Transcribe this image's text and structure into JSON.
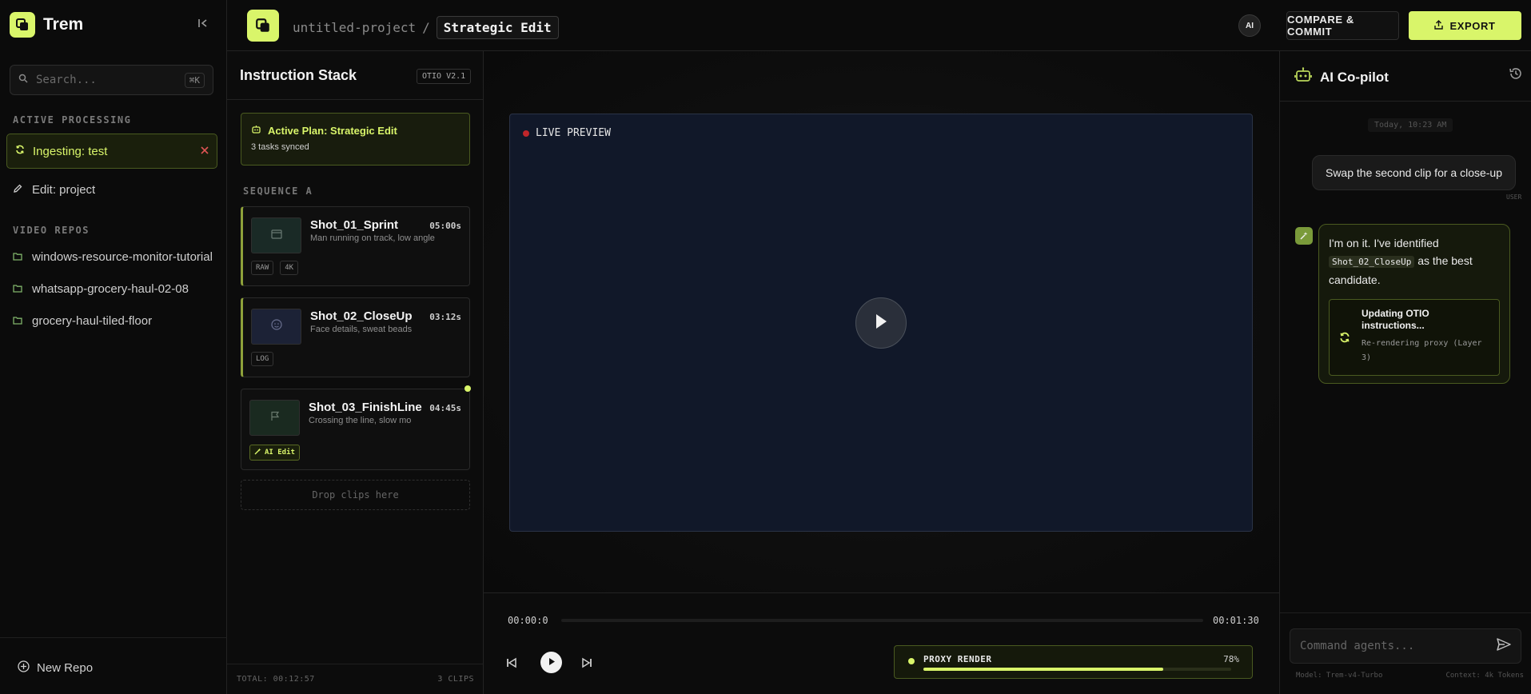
{
  "brand": {
    "name": "Trem"
  },
  "sidebar": {
    "search_placeholder": "Search...",
    "search_shortcut": "⌘K",
    "active_processing_label": "ACTIVE PROCESSING",
    "processing_item": "Ingesting: test",
    "edit_item": "Edit: project",
    "video_repos_label": "VIDEO REPOS",
    "repos": [
      "windows-resource-monitor-tutorial",
      "whatsapp-grocery-haul-02-08",
      "grocery-haul-tiled-floor"
    ],
    "new_repo": "New Repo"
  },
  "topbar": {
    "project": "untitled-project",
    "separator": "/",
    "current": "Strategic Edit",
    "ai_badge": "AI",
    "compare_label": "COMPARE & COMMIT",
    "export_label": "EXPORT"
  },
  "stack": {
    "title": "Instruction Stack",
    "badge": "OTIO V2.1",
    "plan_title": "Active Plan: Strategic Edit",
    "plan_sub": "3 tasks synced",
    "sequence_label": "SEQUENCE A",
    "clips": [
      {
        "name": "Shot_01_Sprint",
        "duration": "05:00s",
        "desc": "Man running on track, low angle",
        "tags": [
          "RAW",
          "4K"
        ]
      },
      {
        "name": "Shot_02_CloseUp",
        "duration": "03:12s",
        "desc": "Face details, sweat beads",
        "tags": [
          "LOG"
        ]
      },
      {
        "name": "Shot_03_FinishLine",
        "duration": "04:45s",
        "desc": "Crossing the line, slow mo",
        "tags": [
          "AI Edit"
        ]
      }
    ],
    "drop_label": "Drop clips here",
    "total": "TOTAL: 00:12:57",
    "count": "3 CLIPS"
  },
  "preview": {
    "live_label": "LIVE PREVIEW",
    "time_start": "00:00:0",
    "time_end": "00:01:30",
    "proxy_label": "PROXY RENDER",
    "proxy_pct": "78%",
    "proxy_fraction": 0.78
  },
  "copilot": {
    "title": "AI Co-pilot",
    "time": "Today, 10:23 AM",
    "user_msg": "Swap the second clip for a close-up",
    "user_tag": "USER",
    "bot_msg_pre": "I'm on it. I've identified",
    "bot_msg_code": "Shot_02_CloseUp",
    "bot_msg_post": "as the best candidate.",
    "task_title": "Updating OTIO instructions...",
    "task_sub": "Re-rendering proxy (Layer 3)",
    "input_placeholder": "Command agents...",
    "model": "Model: Trem-v4-Turbo",
    "context": "Context: 4k Tokens"
  },
  "colors": {
    "accent": "#d9f56a",
    "background": "#0a0a0a",
    "preview_bg": "#111829",
    "rec": "#c0262a"
  }
}
